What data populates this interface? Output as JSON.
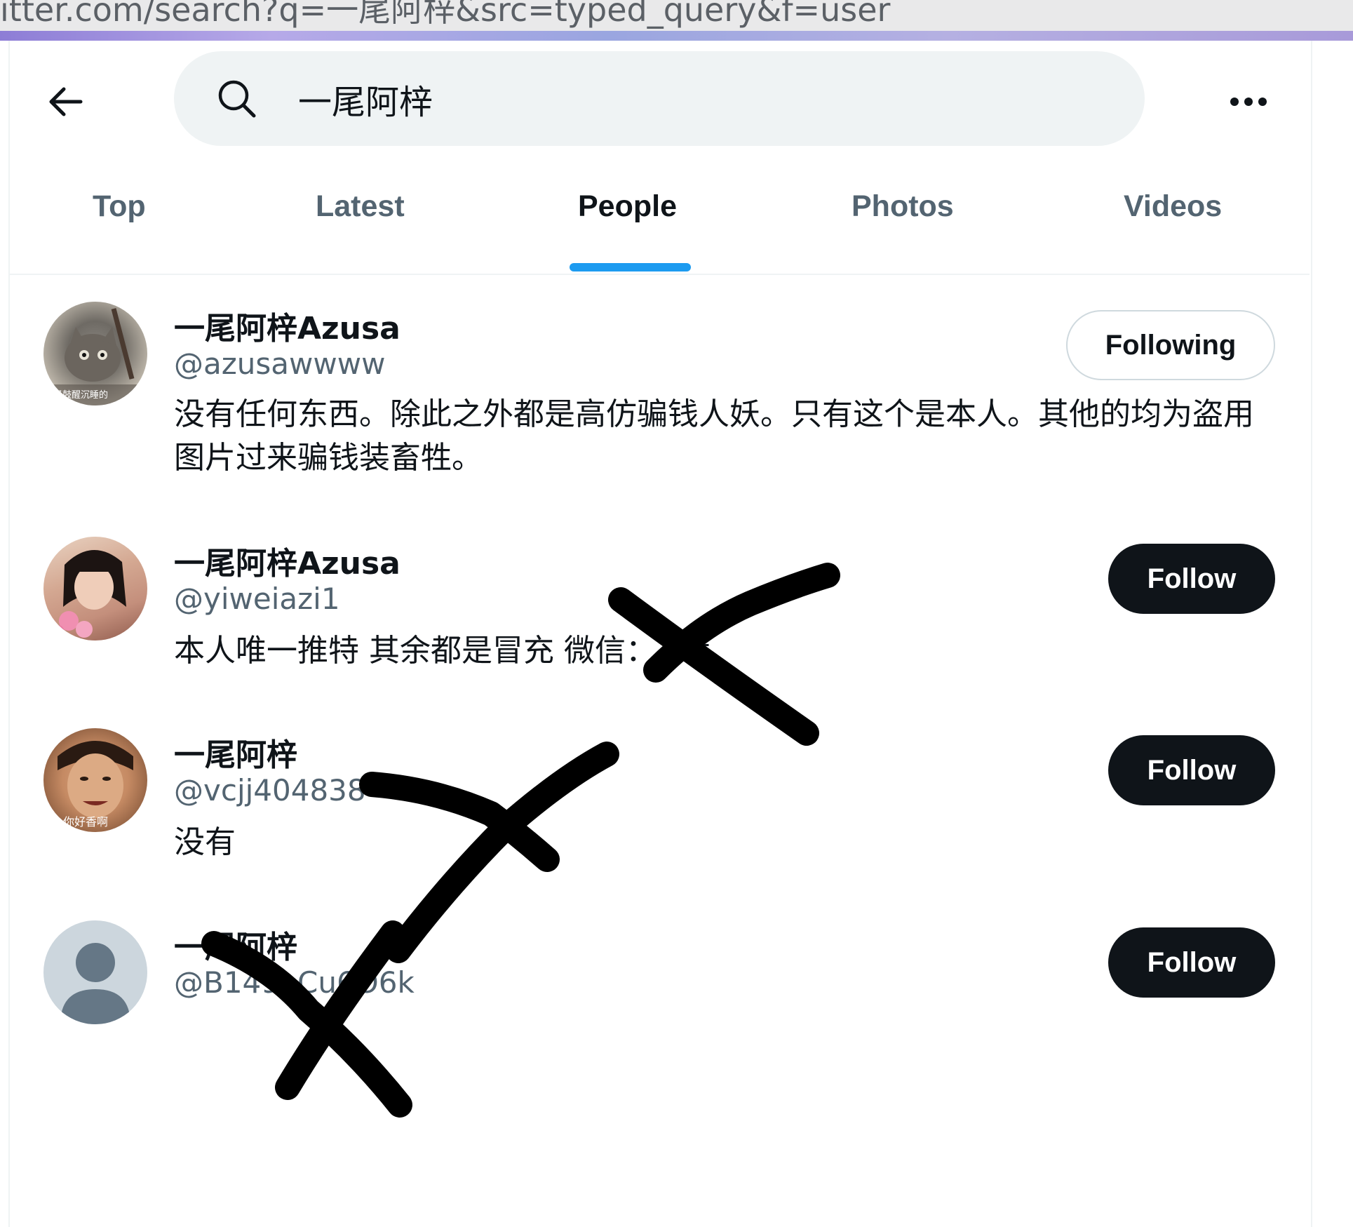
{
  "browser": {
    "url_fragment": "itter.com/search?q=一尾阿梓&src=typed_query&f=user"
  },
  "header": {
    "search_value": "一尾阿梓",
    "back_icon": "arrow-left-icon",
    "more_icon": "more-horizontal-icon"
  },
  "tabs": [
    {
      "label": "Top"
    },
    {
      "label": "Latest"
    },
    {
      "label": "People",
      "active": true
    },
    {
      "label": "Photos"
    },
    {
      "label": "Videos"
    }
  ],
  "results": [
    {
      "name": "一尾阿梓Azusa",
      "handle": "@azusawwww",
      "bio": "没有任何东西。除此之外都是高仿骗钱人妖。只有这个是本人。其他的均为盗用图片过来骗钱装畜牲。",
      "button": "Following",
      "avatar_caption": "经鼓醒沉睡的"
    },
    {
      "name": "一尾阿梓Azusa",
      "handle": "@yiweiazi1",
      "bio": "本人唯一推特 其余都是冒充 微信：  tet",
      "button": "Follow"
    },
    {
      "name": "一尾阿梓",
      "handle": "@vcjj404838",
      "bio": "没有",
      "button": "Follow",
      "avatar_caption": "你好香啊"
    },
    {
      "name": "一尾阿梓",
      "handle": "@B149l    Cu6O6k",
      "bio": "",
      "button": "Follow"
    }
  ],
  "colors": {
    "accent": "#1d9bf0",
    "text_primary": "#0f1419",
    "text_secondary": "#536471",
    "search_bg": "#eff3f4",
    "annotation_ink": "#000000"
  }
}
